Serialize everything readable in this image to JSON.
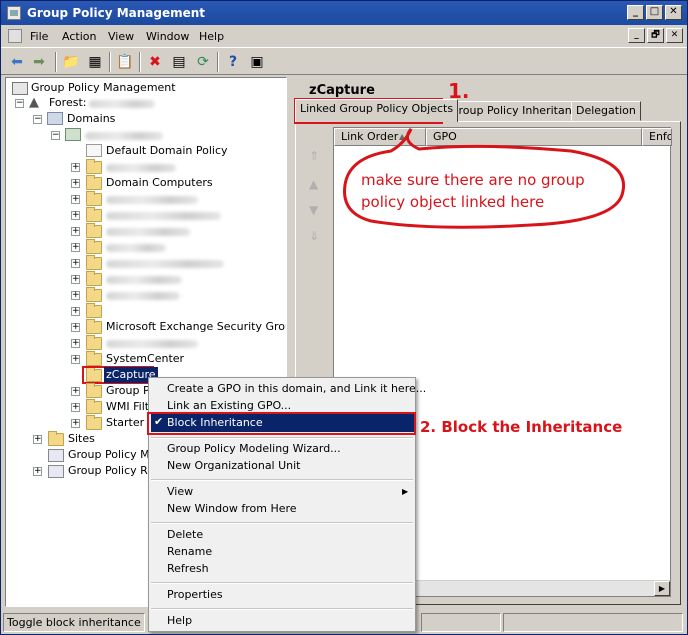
{
  "window": {
    "title": "Group Policy Management"
  },
  "title_buttons": [
    "_",
    "□",
    "✕"
  ],
  "menu": {
    "items": [
      "File",
      "Action",
      "View",
      "Window",
      "Help"
    ]
  },
  "mdi_buttons": [
    "_",
    "🗗",
    "✕"
  ],
  "toolbar": {
    "icons": [
      "back-icon",
      "forward-icon",
      "up-folder-icon",
      "show-hide-tree-icon",
      "properties-icon",
      "delete-icon",
      "export-icon",
      "refresh-icon",
      "help-icon",
      "console-icon"
    ]
  },
  "tree": {
    "root": "Group Policy Management",
    "forest": "Forest:",
    "domains": "Domains",
    "items": {
      "default_domain_policy": "Default Domain Policy",
      "domain_computers": "Domain Computers",
      "exchange_groups": "Microsoft Exchange Security Groups",
      "system_center": "SystemCenter",
      "zcapture": "zCapture",
      "group_policy_partial": "Group Po",
      "wmi_partial": "WMI Filte",
      "starter_partial": "Starter G",
      "sites": "Sites",
      "gp_modeling_partial": "Group Policy Mod",
      "gp_results_partial": "Group Policy Res"
    }
  },
  "right": {
    "title": "zCapture",
    "tabs": [
      "Linked Group Policy Objects",
      "Group Policy Inheritance",
      "Delegation"
    ],
    "columns": [
      "Link Order",
      "GPO",
      "Enfo"
    ]
  },
  "context_menu": {
    "items": [
      "Create a GPO in this domain, and Link it here...",
      "Link an Existing GPO...",
      "Block Inheritance",
      "Group Policy Modeling Wizard...",
      "New Organizational Unit",
      "View",
      "New Window from Here",
      "Delete",
      "Rename",
      "Refresh",
      "Properties",
      "Help"
    ],
    "checked_item": "Block Inheritance"
  },
  "annotations": {
    "step1_number": "1.",
    "step1_note": "make sure there are no group policy object linked here",
    "step2_label": "2. Block the Inheritance",
    "color": "#d9131a"
  },
  "status": {
    "text": "Toggle block inheritance"
  },
  "colors": {
    "titlebar": "#2b58b4",
    "selection": "#0a246a",
    "annotation": "#d9131a"
  }
}
